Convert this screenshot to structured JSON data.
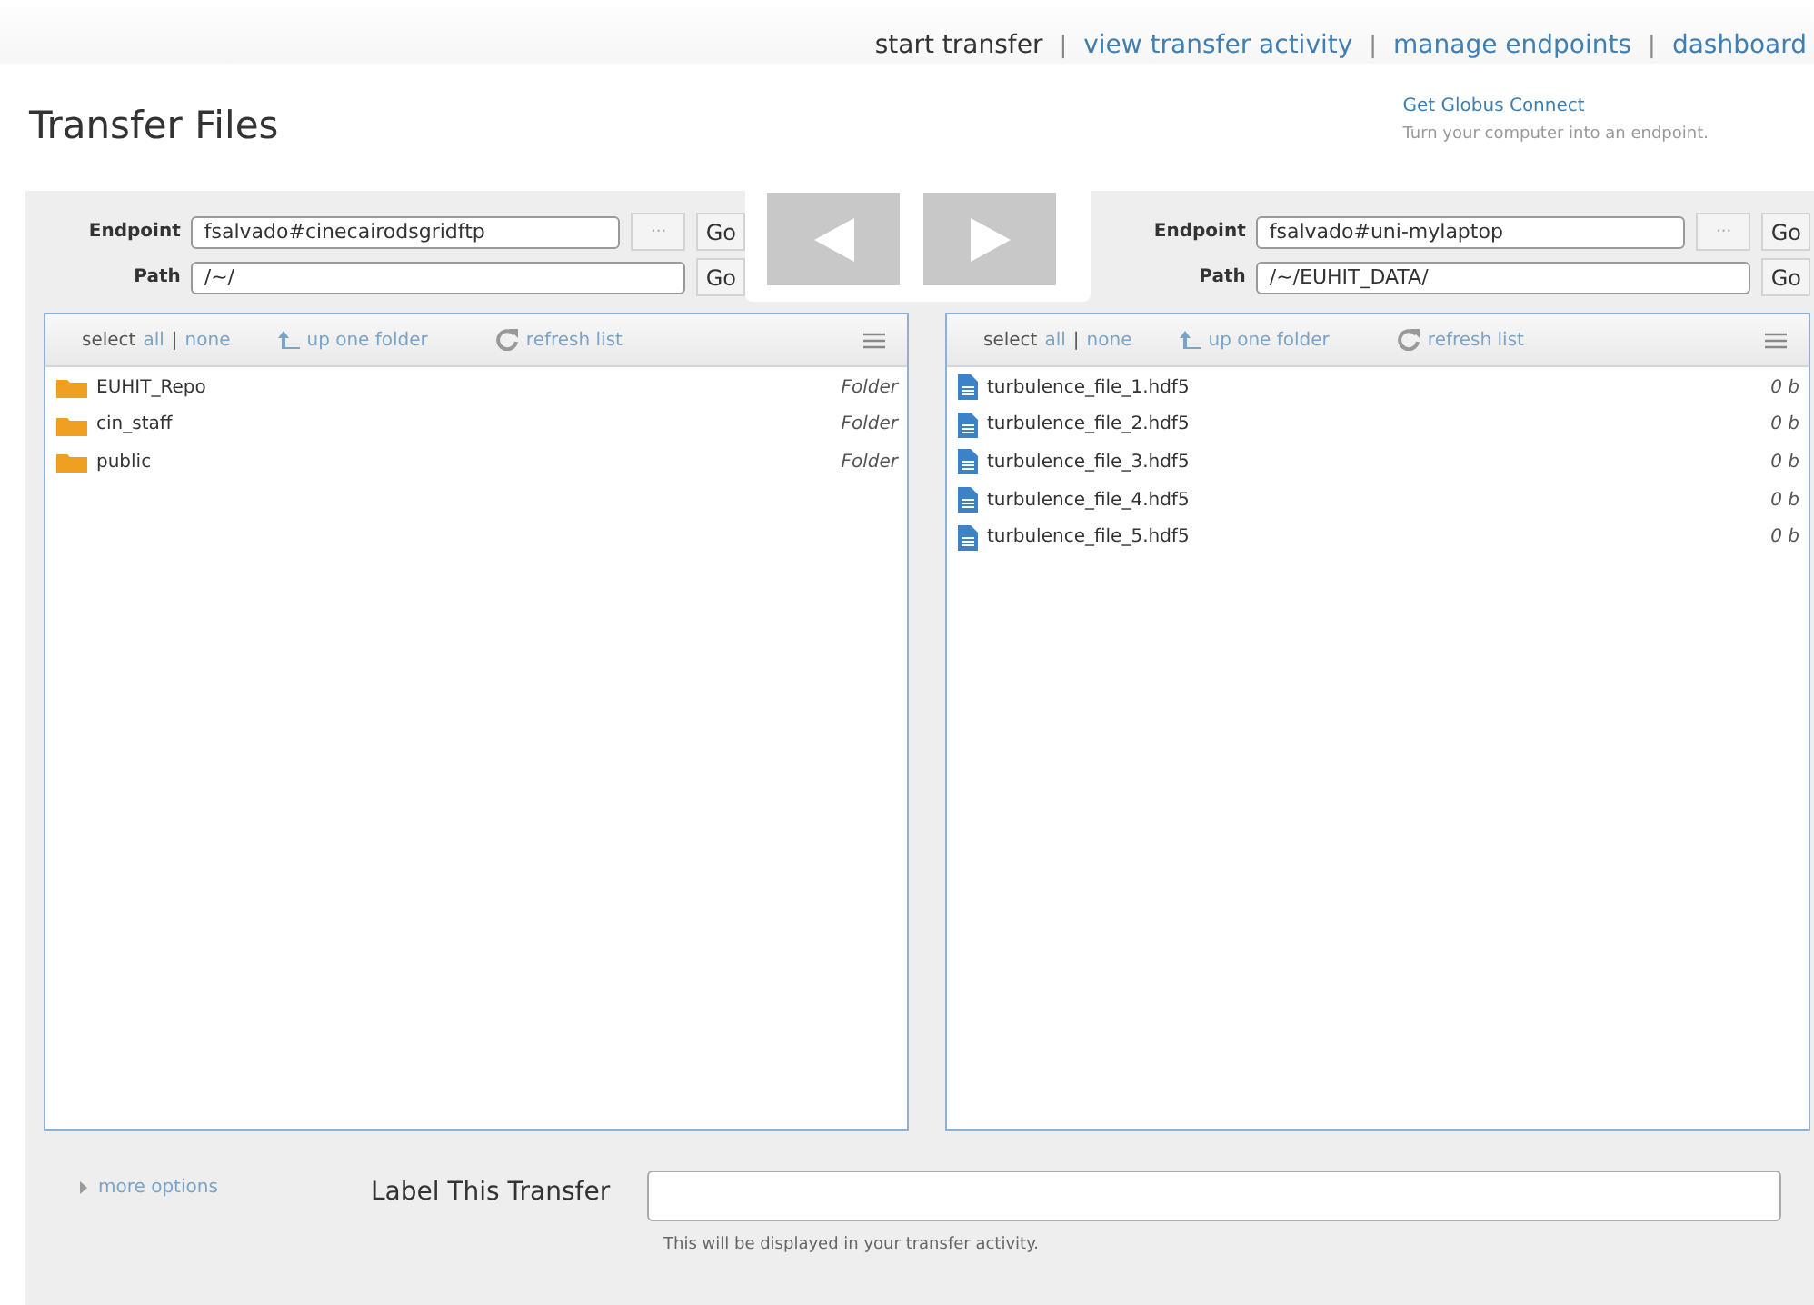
{
  "nav": [
    {
      "label": "start transfer",
      "selected": true
    },
    {
      "label": "view transfer activity",
      "selected": false
    },
    {
      "label": "manage endpoints",
      "selected": false
    },
    {
      "label": "dashboard",
      "selected": false
    }
  ],
  "nav_separator": "|",
  "title": "Transfer Files",
  "globus": {
    "link": "Get Globus Connect",
    "note": "Turn your computer into an endpoint."
  },
  "panes": [
    {
      "endpoint_label": "Endpoint",
      "endpoint": "fsalvado#cinecairodsgridftp",
      "browse": "···",
      "go": "Go",
      "path_label": "Path",
      "path": "/~/",
      "path_go": "Go",
      "toolbar": {
        "select": "select",
        "all": "all",
        "separator": "|",
        "none": "none",
        "up": "up one folder",
        "refresh": "refresh list"
      },
      "items": [
        {
          "kind": "folder",
          "name": "EUHIT_Repo",
          "info": "Folder"
        },
        {
          "kind": "folder",
          "name": "cin_staff",
          "info": "Folder"
        },
        {
          "kind": "folder",
          "name": "public",
          "info": "Folder"
        }
      ]
    },
    {
      "endpoint_label": "Endpoint",
      "endpoint": "fsalvado#uni-mylaptop",
      "browse": "···",
      "go": "Go",
      "path_label": "Path",
      "path": "/~/EUHIT_DATA/",
      "path_go": "Go",
      "toolbar": {
        "select": "select",
        "all": "all",
        "separator": "|",
        "none": "none",
        "up": "up one folder",
        "refresh": "refresh list"
      },
      "items": [
        {
          "kind": "file",
          "name": "turbulence_file_1.hdf5",
          "info": "0 b"
        },
        {
          "kind": "file",
          "name": "turbulence_file_2.hdf5",
          "info": "0 b"
        },
        {
          "kind": "file",
          "name": "turbulence_file_3.hdf5",
          "info": "0 b"
        },
        {
          "kind": "file",
          "name": "turbulence_file_4.hdf5",
          "info": "0 b"
        },
        {
          "kind": "file",
          "name": "turbulence_file_5.hdf5",
          "info": "0 b"
        }
      ]
    }
  ],
  "more_options": "more options",
  "label_field": {
    "label": "Label This Transfer",
    "hint": "This will be displayed in your transfer activity."
  }
}
